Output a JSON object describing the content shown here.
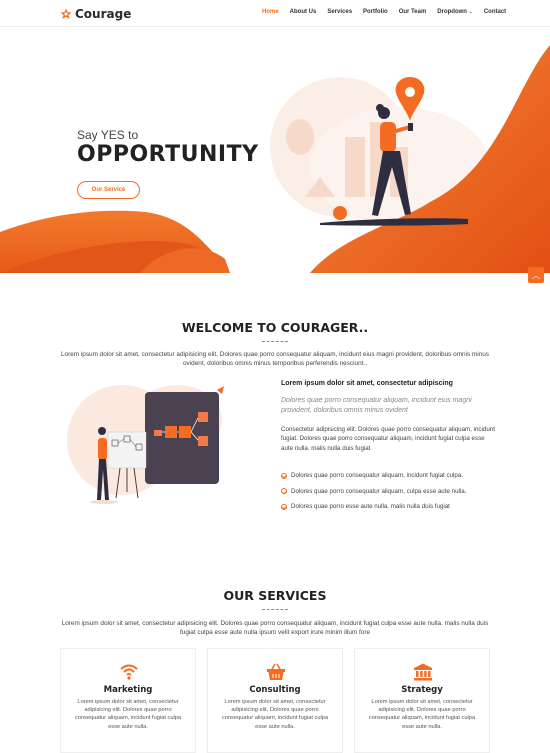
{
  "brand": {
    "name": "Courage",
    "accent": "#f46c23"
  },
  "nav": {
    "items": [
      {
        "label": "Home",
        "active": true
      },
      {
        "label": "About Us"
      },
      {
        "label": "Services"
      },
      {
        "label": "Portfolio"
      },
      {
        "label": "Our Team"
      },
      {
        "label": "Dropdown"
      },
      {
        "label": "Contact"
      }
    ]
  },
  "hero": {
    "subtitle": "Say YES to",
    "title": "OPPORTUNITY",
    "button": "Our Service"
  },
  "scroll_top_icon": "chevron-up-icon",
  "welcome": {
    "title": "WELCOME TO COURAGER..",
    "lead": "Lorem ipsum dolor sit amet, consectetur adipisicing elit. Dolores quae porro consequatur aliquam, incidunt eius magni provident, doloribus omnis minus ovident, doloribus omnis minus temporibus perferendis nesciunt..",
    "heading": "Lorem ipsum dolor sit amet, consectetur adipiscing",
    "italic": "Dolores quae porro consequatur aliquam, incidunt eius magni provident, doloribus omnis minus ovident",
    "body": "Consectetur adipisicing elit. Dolores quae porro consequatur aliquam, incidunt fugiat. Dolores quae porro consequatur aliquam, incidunt fugiat culpa esse aute nulla. malis nulla duis fugiat",
    "list": [
      "Dolores quae porro consequatur aliquam, incidunt fugiat culpa.",
      "Dolores quae porro consequatur aliquam, culpa esse aute nulla.",
      "Dolores quae porro esse aute nulla. malis nulla duis fugiat"
    ]
  },
  "services": {
    "title": "OUR SERVICES",
    "lead": "Lorem ipsum dolor sit amet, consectetur adipisicing elit. Dolores quae porro consequatur aliquam, incidunt fugiat culpa esse aute nulla. malis nulla duis fugiat culpa esse aute nulla ipsum velit export irure minim illum fore",
    "cards": [
      {
        "icon": "wifi-icon",
        "title": "Marketing",
        "text": "Lorem ipsum dolor sit amet, consectetur adipisicing elit. Dolores quae porro consequatur aliquam, incidunt fugiat culpa esse aute nulla."
      },
      {
        "icon": "basket-icon",
        "title": "Consulting",
        "text": "Lorem ipsum dolor sit amet, consectetur adipisicing elit. Dolores quae porro consequatur aliquam, incidunt fugiat culpa esse aute nulla."
      },
      {
        "icon": "bank-icon",
        "title": "Strategy",
        "text": "Lorem ipsum dolor sit amet, consectetur adipisicing elit. Dolores quae porro consequatur aliquam, incidunt fugiat culpa esse aute nulla."
      }
    ]
  }
}
